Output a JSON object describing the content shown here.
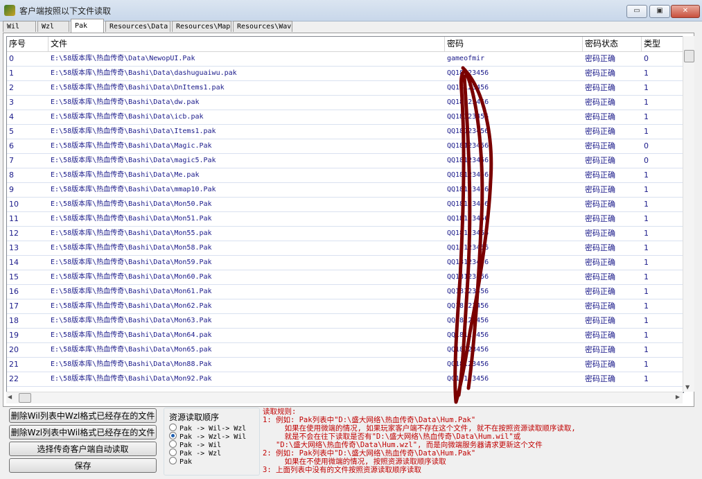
{
  "window": {
    "title": "客户端按照以下文件读取",
    "minimize_glyph": "▭",
    "maximize_glyph": "▣",
    "close_glyph": "✕"
  },
  "tabs": [
    {
      "label": "Wil"
    },
    {
      "label": "Wzl"
    },
    {
      "label": "Pak",
      "active": true
    },
    {
      "label": "Resources\\Data"
    },
    {
      "label": "Resources\\Map"
    },
    {
      "label": "Resources\\Wav"
    }
  ],
  "columns": [
    "序号",
    "文件",
    "密码",
    "密码状态",
    "类型"
  ],
  "rows": [
    {
      "id": "0",
      "file": "E:\\58版本库\\热血传奇\\Data\\NewopUI.Pak",
      "password": "gameofmir",
      "status": "密码正确",
      "type": "0"
    },
    {
      "id": "1",
      "file": "E:\\58版本库\\热血传奇\\Bashi\\Data\\dashuguaiwu.pak",
      "password": "QQ18123456",
      "status": "密码正确",
      "type": "1"
    },
    {
      "id": "2",
      "file": "E:\\58版本库\\热血传奇\\Bashi\\Data\\DnItems1.pak",
      "password": "QQ18123456",
      "status": "密码正确",
      "type": "1"
    },
    {
      "id": "3",
      "file": "E:\\58版本库\\热血传奇\\Bashi\\Data\\dw.pak",
      "password": "QQ18123456",
      "status": "密码正确",
      "type": "1"
    },
    {
      "id": "4",
      "file": "E:\\58版本库\\热血传奇\\Bashi\\Data\\icb.pak",
      "password": "QQ18123456",
      "status": "密码正确",
      "type": "1"
    },
    {
      "id": "5",
      "file": "E:\\58版本库\\热血传奇\\Bashi\\Data\\Items1.pak",
      "password": "QQ18123456",
      "status": "密码正确",
      "type": "1"
    },
    {
      "id": "6",
      "file": "E:\\58版本库\\热血传奇\\Bashi\\Data\\Magic.Pak",
      "password": "QQ18123456",
      "status": "密码正确",
      "type": "0"
    },
    {
      "id": "7",
      "file": "E:\\58版本库\\热血传奇\\Bashi\\Data\\magic5.Pak",
      "password": "QQ18123456",
      "status": "密码正确",
      "type": "0"
    },
    {
      "id": "8",
      "file": "E:\\58版本库\\热血传奇\\Bashi\\Data\\Me.pak",
      "password": "QQ18123456",
      "status": "密码正确",
      "type": "1"
    },
    {
      "id": "9",
      "file": "E:\\58版本库\\热血传奇\\Bashi\\Data\\mmap10.Pak",
      "password": "QQ18123456",
      "status": "密码正确",
      "type": "1"
    },
    {
      "id": "10",
      "file": "E:\\58版本库\\热血传奇\\Bashi\\Data\\Mon50.Pak",
      "password": "QQ18123456",
      "status": "密码正确",
      "type": "1"
    },
    {
      "id": "11",
      "file": "E:\\58版本库\\热血传奇\\Bashi\\Data\\Mon51.Pak",
      "password": "QQ18123456",
      "status": "密码正确",
      "type": "1"
    },
    {
      "id": "12",
      "file": "E:\\58版本库\\热血传奇\\Bashi\\Data\\Mon55.pak",
      "password": "QQ18123456",
      "status": "密码正确",
      "type": "1"
    },
    {
      "id": "13",
      "file": "E:\\58版本库\\热血传奇\\Bashi\\Data\\Mon58.Pak",
      "password": "QQ18123456",
      "status": "密码正确",
      "type": "1"
    },
    {
      "id": "14",
      "file": "E:\\58版本库\\热血传奇\\Bashi\\Data\\Mon59.Pak",
      "password": "QQ18123456",
      "status": "密码正确",
      "type": "1"
    },
    {
      "id": "15",
      "file": "E:\\58版本库\\热血传奇\\Bashi\\Data\\Mon60.Pak",
      "password": "QQ18123456",
      "status": "密码正确",
      "type": "1"
    },
    {
      "id": "16",
      "file": "E:\\58版本库\\热血传奇\\Bashi\\Data\\Mon61.Pak",
      "password": "QQ18123456",
      "status": "密码正确",
      "type": "1"
    },
    {
      "id": "17",
      "file": "E:\\58版本库\\热血传奇\\Bashi\\Data\\Mon62.Pak",
      "password": "QQ18123456",
      "status": "密码正确",
      "type": "1"
    },
    {
      "id": "18",
      "file": "E:\\58版本库\\热血传奇\\Bashi\\Data\\Mon63.Pak",
      "password": "QQ18123456",
      "status": "密码正确",
      "type": "1"
    },
    {
      "id": "19",
      "file": "E:\\58版本库\\热血传奇\\Bashi\\Data\\Mon64.pak",
      "password": "QQ18123456",
      "status": "密码正确",
      "type": "1"
    },
    {
      "id": "20",
      "file": "E:\\58版本库\\热血传奇\\Bashi\\Data\\Mon65.pak",
      "password": "QQ18123456",
      "status": "密码正确",
      "type": "1"
    },
    {
      "id": "21",
      "file": "E:\\58版本库\\热血传奇\\Bashi\\Data\\Mon88.Pak",
      "password": "QQ18123456",
      "status": "密码正确",
      "type": "1"
    },
    {
      "id": "22",
      "file": "E:\\58版本库\\热血传奇\\Bashi\\Data\\Mon92.Pak",
      "password": "QQ18123456",
      "status": "密码正确",
      "type": "1"
    }
  ],
  "buttons": {
    "delete_wil": "删除Wil列表中Wzl格式已经存在的文件",
    "delete_wzl": "删除Wzl列表中Wil格式已经存在的文件",
    "select_client": "选择传奇客户端自动读取",
    "save": "保存"
  },
  "order_group": {
    "title": "资源读取顺序",
    "options": [
      {
        "label": "Pak -> Wil-> Wzl",
        "checked": false
      },
      {
        "label": "Pak -> Wzl-> Wil",
        "checked": true
      },
      {
        "label": "Pak -> Wil",
        "checked": false
      },
      {
        "label": "Pak -> Wzl",
        "checked": false
      },
      {
        "label": "Pak",
        "checked": false
      }
    ]
  },
  "rules": [
    "读取规则:",
    "1: 例如: Pak列表中\"D:\\盛大网络\\热血传奇\\Data\\Hum.Pak\"",
    "     如果在使用微端的情况, 如果玩家客户端不存在这个文件, 就不在按照资源读取顺序读取,",
    "     就是不会在往下读取是否有\"D:\\盛大网络\\热血传奇\\Data\\Hum.wil\"或",
    "   \"D:\\盛大网络\\热血传奇\\Data\\Hum.wzl\", 而是向微端服务器请求更新这个文件",
    "2: 例如: Pak列表中\"D:\\盛大网络\\热血传奇\\Data\\Hum.Pak\"",
    "     如果在不使用微端的情况, 按照资源读取顺序读取",
    "3: 上面列表中没有的文件按照资源读取顺序读取"
  ],
  "colors": {
    "link_blue": "#1a1a8a",
    "rule_red": "#c00000",
    "scribble": "#7a0000"
  }
}
